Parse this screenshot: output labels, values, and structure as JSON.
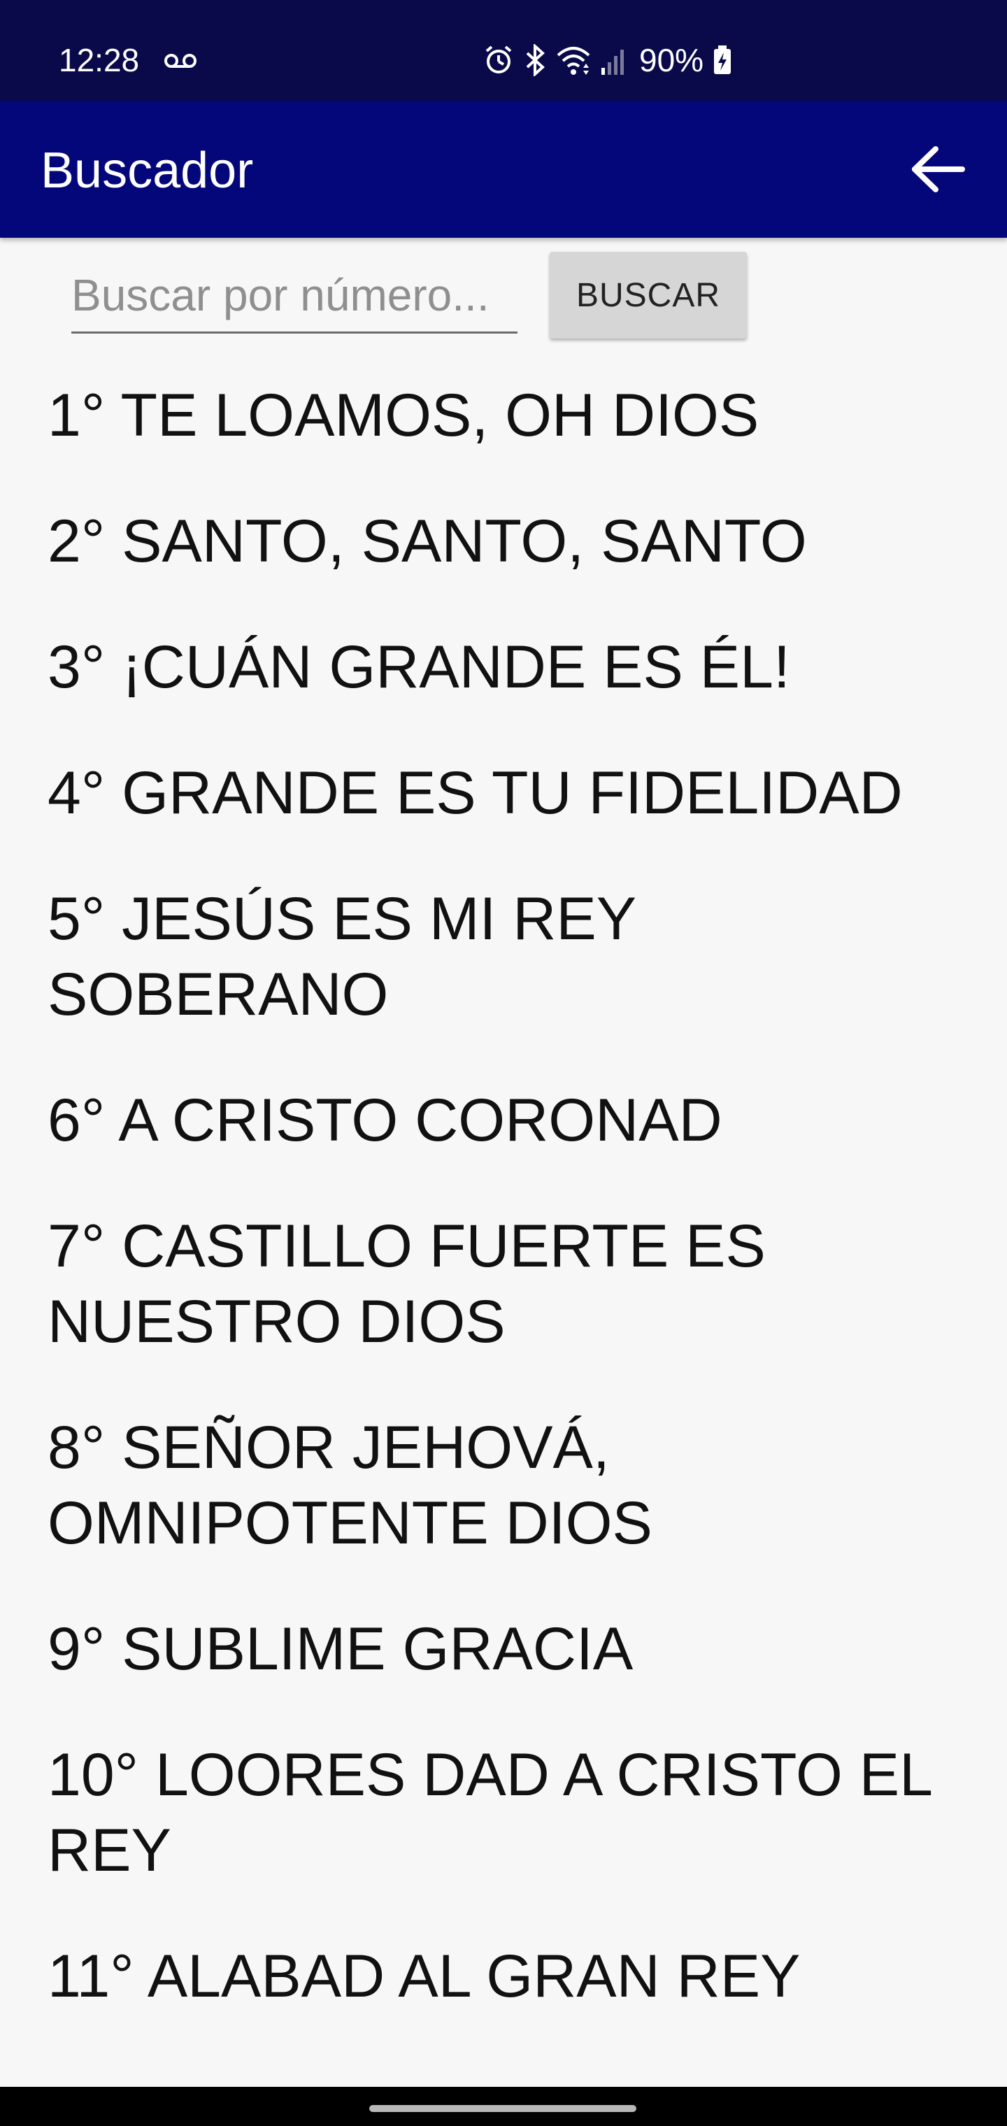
{
  "status_bar": {
    "time": "12:28",
    "battery": "90%",
    "icons": [
      "voicemail-icon",
      "alarm-icon",
      "bluetooth-icon",
      "wifi-icon",
      "signal-icon",
      "battery-charging-icon"
    ]
  },
  "app_bar": {
    "title": "Buscador",
    "back_icon": "arrow-left-icon"
  },
  "search": {
    "placeholder": "Buscar por número...",
    "value": "",
    "button_label": "BUSCAR"
  },
  "results": [
    "1° TE LOAMOS, OH DIOS",
    "2° SANTO, SANTO, SANTO",
    "3° ¡CUÁN GRANDE ES ÉL!",
    "4° GRANDE ES TU FIDELIDAD",
    "5° JESÚS ES MI REY SOBERANO",
    "6° A CRISTO CORONAD",
    "7° CASTILLO FUERTE ES NUESTRO DIOS",
    "8° SEÑOR JEHOVÁ, OMNIPOTENTE DIOS",
    "9° SUBLIME GRACIA",
    "10° LOORES DAD A CRISTO EL REY",
    "11° ALABAD AL GRAN REY"
  ],
  "colors": {
    "status_bar": "#0a0a4a",
    "app_bar": "#04077a",
    "background": "#f7f7f7",
    "button": "#d6d6d6"
  }
}
